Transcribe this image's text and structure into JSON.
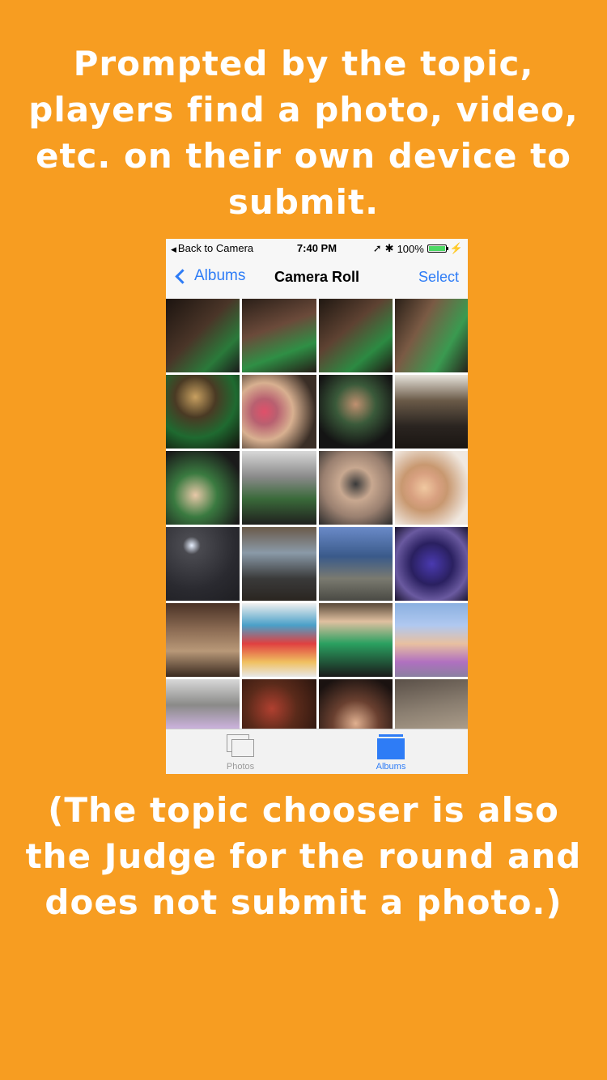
{
  "headline": [
    "Prompted by the topic,",
    "players find a photo, video,",
    "etc. on their own device to",
    "submit."
  ],
  "status_bar": {
    "back_label": "Back to Camera",
    "time": "7:40 PM",
    "battery": "100%"
  },
  "nav": {
    "back_label": "Albums",
    "title": "Camera Roll",
    "select_label": "Select"
  },
  "photos": [
    {
      "bg": "linear-gradient(135deg,#1c1410 0%,#4a3528 45%,#2a7a3a 75%,#1a1a1a 100%)"
    },
    {
      "bg": "linear-gradient(160deg,#2a1f18 0%,#6b4a3a 40%,#2f8f45 70%,#241c16 100%)"
    },
    {
      "bg": "linear-gradient(140deg,#201812 0%,#5e4232 40%,#2c8a42 72%,#1e1612 100%)"
    },
    {
      "bg": "linear-gradient(120deg,#2a2018 0%,#7a5a44 35%,#3a9a50 70%,#26201a 100%)"
    },
    {
      "bg": "radial-gradient(circle at 40% 30%,#c8a060 0%,#4a3a24 30%,#1f6a30 60%,#120e0a 100%)"
    },
    {
      "bg": "radial-gradient(circle at 30% 50%,#e0506a 0%,#b86070 20%,#d8b090 45%,#3a2e26 80%)"
    },
    {
      "bg": "radial-gradient(circle at 50% 40%,#c09070 0%,#3a5a3a 35%,#141414 75%)"
    },
    {
      "bg": "linear-gradient(180deg,#e8e4dc 0%,#6a5a48 35%,#2a2420 70%,#1a1612 100%)"
    },
    {
      "bg": "radial-gradient(circle at 40% 60%,#e8c8a8 0%,#3a7a40 35%,#1a1a1a 80%)"
    },
    {
      "bg": "linear-gradient(180deg,#d8d8d8 0%,#8a8a8a 35%,#3a6a3a 65%,#20201e 100%)"
    },
    {
      "bg": "radial-gradient(circle at 50% 45%,#3a3a3a 0%,#c8a890 30%,#9a8070 60%,#2a2a2a 100%)"
    },
    {
      "bg": "radial-gradient(circle at 40% 50%,#f0c8a0 0%,#d8a080 25%,#c89870 40%,#f0e8e0 80%)"
    },
    {
      "bg": "radial-gradient(circle at 35% 25%,#e8f0ff 0%,#4a4a50 12%,#2a2a30 60%,#1e1e22 100%)"
    },
    {
      "bg": "linear-gradient(180deg,#6a5a4a 0%,#8a9aa8 35%,#3a3a3a 70%,#2a2520 100%)"
    },
    {
      "bg": "linear-gradient(180deg,#6a8ac8 0%,#3a5a8a 40%,#7a7a70 70%,#4a4a44 100%)"
    },
    {
      "bg": "radial-gradient(circle at 50% 50%,#4a3ab0 0%,#2a2060 40%,#6a5aa0 70%,#1a1430 100%)"
    },
    {
      "bg": "linear-gradient(180deg,#4a3226 0%,#8a6a52 35%,#b89878 65%,#3a2a20 100%)"
    },
    {
      "bg": "linear-gradient(180deg,#f0f0f0 0%,#4aa0c8 30%,#e04040 55%,#f0c060 80%,#e8e8e8 100%)"
    },
    {
      "bg": "linear-gradient(180deg,#5a4a3a 0%,#e0c0a0 25%,#2aa060 55%,#1a1a1a 100%)"
    },
    {
      "bg": "linear-gradient(180deg,#8ab0e0 0%,#b0c8f0 30%,#e8c0a0 55%,#b070c0 80%,#8a80a0 100%)"
    },
    {
      "bg": "linear-gradient(180deg,#d8d8d8 0%,#8a8a88 35%,#c8b0d8 65%,#a0a0a0 100%)"
    },
    {
      "bg": "radial-gradient(circle at 40% 40%,#b04030 0%,#5a2a1a 40%,#1a0e0a 100%)"
    },
    {
      "bg": "radial-gradient(circle at 50% 60%,#e0b090 0%,#6a4030 40%,#1a1210 85%)"
    },
    {
      "bg": "linear-gradient(170deg,#5a5048 0%,#8a7e70 40%,#a89a88 70%,#6a6058 100%)"
    }
  ],
  "tabs": {
    "photos_label": "Photos",
    "albums_label": "Albums"
  },
  "footer": [
    "(The topic chooser is also",
    "the Judge for the round and",
    "does not submit a photo.)"
  ]
}
